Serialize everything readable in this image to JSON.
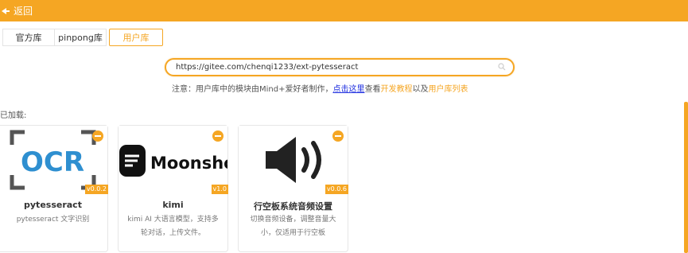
{
  "header": {
    "back_label": "返回",
    "accent": "#f5a623"
  },
  "tabs": [
    {
      "label": "官方库"
    },
    {
      "label": "pinpong库"
    },
    {
      "label": "用户库",
      "active": true
    }
  ],
  "search": {
    "value": "https://gitee.com/chenqi1233/ext-pytesseract",
    "icon": "search-icon"
  },
  "notice": {
    "prefix": "注意：用户库中的模块由Mind+爱好者制作，",
    "link": "点击这里",
    "middle": "查看",
    "dev_tutorial": "开发教程",
    "and": "以及",
    "user_list": "用户库列表"
  },
  "loaded_label": "已加载:",
  "cards": [
    {
      "title": "pytesseract",
      "desc": "pytesseract 文字识别",
      "version": "v0.0.2",
      "image": "OCR"
    },
    {
      "title": "kimi",
      "desc": "kimi AI 大语言模型，支持多轮对话，上传文件。",
      "version": "v1.0",
      "image": "Moonshot"
    },
    {
      "title": "行空板系统音频设置",
      "desc": "切换音频设备，调整音量大小，仅适用于行空板",
      "version": "v0.0.6",
      "image": "speaker"
    }
  ]
}
